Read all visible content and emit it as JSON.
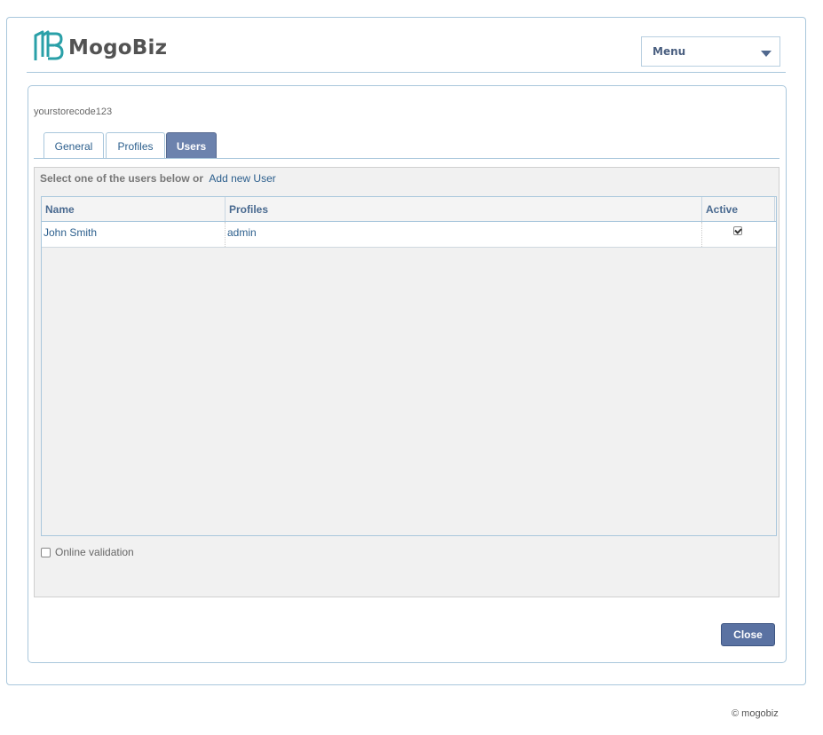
{
  "header": {
    "logo_text": "MogoBiz",
    "menu_label": "Menu"
  },
  "store": {
    "code": "yourstorecode123"
  },
  "tabs": [
    {
      "label": "General",
      "active": false
    },
    {
      "label": "Profiles",
      "active": false
    },
    {
      "label": "Users",
      "active": true
    }
  ],
  "users_panel": {
    "intro_text": "Select one of the users below or",
    "add_link": "Add new User",
    "columns": [
      "Name",
      "Profiles",
      "Active"
    ],
    "rows": [
      {
        "name": "John Smith",
        "profiles": "admin",
        "active": true
      }
    ],
    "online_validation_label": "Online validation",
    "online_validation_checked": false
  },
  "actions": {
    "close_label": "Close"
  },
  "footer": {
    "text": "© mogobiz"
  },
  "colors": {
    "accent": "#6c82ad",
    "link": "#2c5f8d",
    "border": "#a9c7dc",
    "logo_icon": "#2aa0a8"
  },
  "icons": {
    "logo": "mogobiz-logo-icon",
    "menu_caret": "chevron-down-icon"
  }
}
